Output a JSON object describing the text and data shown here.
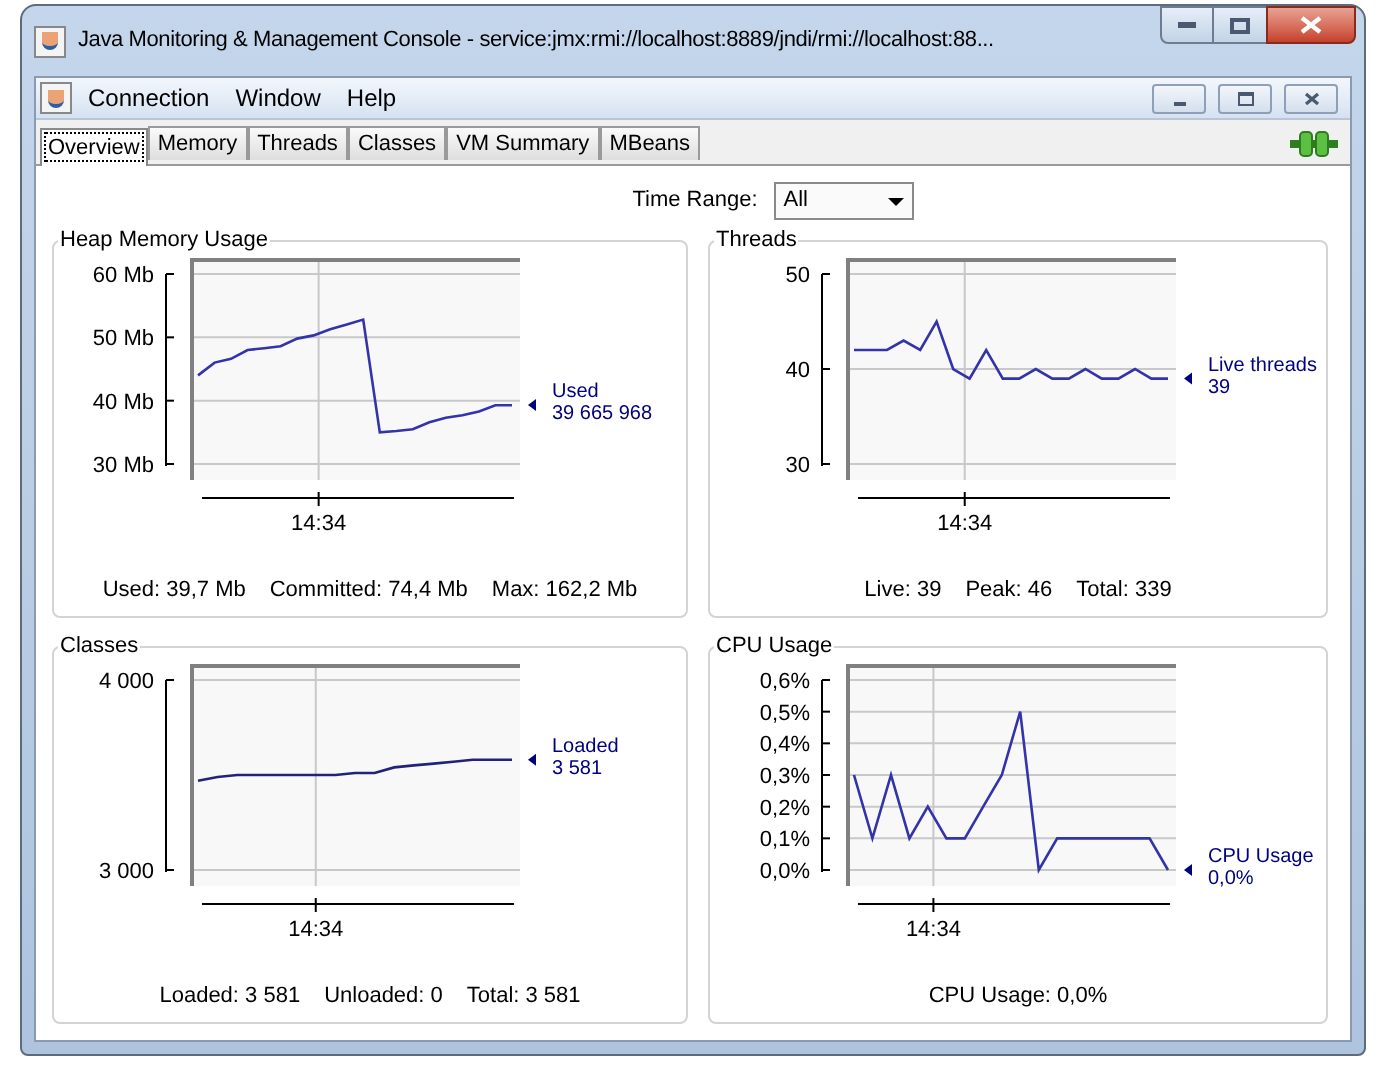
{
  "window": {
    "title": "Java Monitoring & Management Console - service:jmx:rmi://localhost:8889/jndi/rmi://localhost:88..."
  },
  "menu": [
    "Connection",
    "Window",
    "Help"
  ],
  "tabs": [
    {
      "label": "Overview",
      "selected": true
    },
    {
      "label": "Memory",
      "selected": false
    },
    {
      "label": "Threads",
      "selected": false
    },
    {
      "label": "Classes",
      "selected": false
    },
    {
      "label": "VM Summary",
      "selected": false
    },
    {
      "label": "MBeans",
      "selected": false
    }
  ],
  "time_range": {
    "label": "Time Range:",
    "value": "All"
  },
  "panels": [
    {
      "title": "Heap Memory Usage",
      "time_label": "14:34",
      "legend_value": "39 665 968",
      "stats": [
        "Used: 39,7 Mb",
        "Committed: 74,4 Mb",
        "Max: 162,2 Mb"
      ],
      "chart_data": {
        "type": "line",
        "grid": true,
        "ylim": [
          30,
          60
        ],
        "yticks": [
          {
            "value": 30,
            "label": "30 Mb"
          },
          {
            "value": 40,
            "label": "40 Mb"
          },
          {
            "value": 50,
            "label": "50 Mb"
          },
          {
            "value": 60,
            "label": "60 Mb"
          }
        ],
        "series": [
          {
            "name": "Used",
            "color": "#3333aa",
            "values": [
              44,
              46,
              46.6,
              48,
              48.3,
              48.6,
              49.8,
              50.3,
              51.3,
              52,
              52.8,
              35,
              35.2,
              35.5,
              36.6,
              37.3,
              37.7,
              38.3,
              39.3,
              39.3
            ]
          }
        ]
      }
    },
    {
      "title": "Threads",
      "time_label": "14:34",
      "legend_value": "39",
      "stats": [
        "Live: 39",
        "Peak: 46",
        "Total: 339"
      ],
      "chart_data": {
        "type": "line",
        "grid": true,
        "ylim": [
          30,
          50
        ],
        "yticks": [
          {
            "value": 30,
            "label": "30"
          },
          {
            "value": 40,
            "label": "40"
          },
          {
            "value": 50,
            "label": "50"
          }
        ],
        "series": [
          {
            "name": "Live threads",
            "color": "#3333aa",
            "values": [
              42,
              42,
              42,
              43,
              42,
              45,
              40,
              39,
              42,
              39,
              39,
              40,
              39,
              39,
              40,
              39,
              39,
              40,
              39,
              39
            ]
          }
        ]
      }
    },
    {
      "title": "Classes",
      "time_label": "14:34",
      "legend_value": "3 581",
      "stats": [
        "Loaded: 3 581",
        "Unloaded: 0",
        "Total: 3 581"
      ],
      "chart_data": {
        "type": "line",
        "grid": true,
        "ylim": [
          3000,
          4000
        ],
        "yticks": [
          {
            "value": 3000,
            "label": "3 000"
          },
          {
            "value": 4000,
            "label": "4 000"
          }
        ],
        "series": [
          {
            "name": "Loaded",
            "color": "#22227a",
            "values": [
              3470,
              3490,
              3500,
              3500,
              3500,
              3500,
              3500,
              3500,
              3510,
              3510,
              3540,
              3550,
              3560,
              3570,
              3580,
              3580,
              3580
            ]
          }
        ]
      }
    },
    {
      "title": "CPU Usage",
      "time_label": "14:34",
      "legend_value": "0,0%",
      "stats": [
        "CPU Usage: 0,0%"
      ],
      "chart_data": {
        "type": "line",
        "grid": true,
        "ylim": [
          0,
          0.6
        ],
        "yticks": [
          {
            "value": 0,
            "label": "0,0%"
          },
          {
            "value": 0.1,
            "label": "0,1%"
          },
          {
            "value": 0.2,
            "label": "0,2%"
          },
          {
            "value": 0.3,
            "label": "0,3%"
          },
          {
            "value": 0.4,
            "label": "0,4%"
          },
          {
            "value": 0.5,
            "label": "0,5%"
          },
          {
            "value": 0.6,
            "label": "0,6%"
          }
        ],
        "series": [
          {
            "name": "CPU Usage",
            "color": "#3333aa",
            "values": [
              0.3,
              0.1,
              0.3,
              0.1,
              0.2,
              0.1,
              0.1,
              0.2,
              0.3,
              0.5,
              0,
              0.1,
              0.1,
              0.1,
              0.1,
              0.1,
              0.1,
              0
            ]
          }
        ]
      }
    }
  ]
}
